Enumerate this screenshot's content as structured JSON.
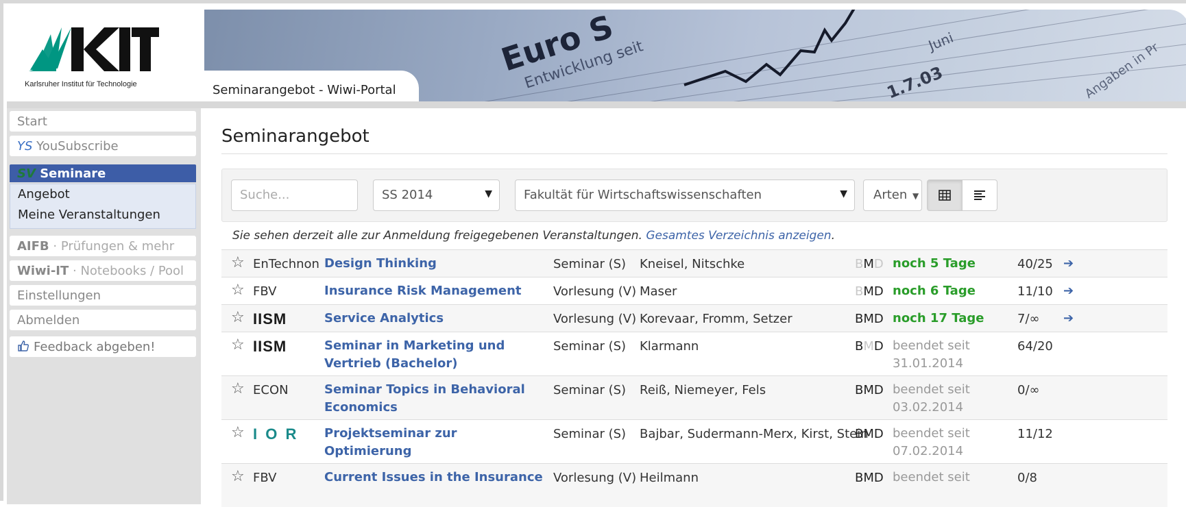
{
  "header": {
    "logo_text": "KIT",
    "logo_subtitle": "Karlsruher Institut für Technologie",
    "portal_title": "Seminarangebot - Wiwi-Portal",
    "banner_words": [
      "Euro S",
      "Entwicklung seit",
      "Juni",
      "1.7.03",
      "Angaben in Pr"
    ]
  },
  "sidebar": {
    "start": "Start",
    "yousubscribe_prefix": "YS",
    "yousubscribe_label": "YouSubscribe",
    "seminare_prefix": "SV",
    "seminare_label": "Seminare",
    "sub_angebot": "Angebot",
    "sub_meine": "Meine Veranstaltungen",
    "aifb_a": "AIFB",
    "aifb_sep": " · ",
    "aifb_b": "Prüfungen & mehr",
    "wiwi_a": "Wiwi-IT",
    "wiwi_sep": " · ",
    "wiwi_b": "Notebooks / Pool",
    "einstellungen": "Einstellungen",
    "abmelden": "Abmelden",
    "feedback": "Feedback abgeben!"
  },
  "main": {
    "title": "Seminarangebot",
    "search_placeholder": "Suche...",
    "semester": "SS 2014",
    "faculty": "Fakultät für Wirtschaftswissenschaften",
    "arten": "Arten",
    "info_text": "Sie sehen derzeit alle zur Anmeldung freigegebenen Veranstaltungen.",
    "info_link": "Gesamtes Verzeichnis anzeigen",
    "info_end": "."
  },
  "rows": [
    {
      "inst": "EnTechnon",
      "title": "Design Thinking",
      "type": "Seminar (S)",
      "prof": "Kneisel, Nitschke",
      "b": "B",
      "m": "M",
      "d": "D",
      "status": "noch 5 Tage",
      "count": "40/25"
    },
    {
      "inst": "FBV",
      "title": "Insurance Risk Management",
      "type": "Vorlesung (V)",
      "prof": "Maser",
      "b": "B",
      "m": "M",
      "d": "D",
      "status": "noch 6 Tage",
      "count": "11/10"
    },
    {
      "inst": "IISM",
      "title": "Service Analytics",
      "type": "Vorlesung (V)",
      "prof": "Korevaar, Fromm, Setzer",
      "b": "B",
      "m": "M",
      "d": "D",
      "status": "noch 17 Tage",
      "count": "7/∞"
    },
    {
      "inst": "IISM",
      "title": "Seminar in Marketing und Vertrieb (Bachelor)",
      "type": "Seminar (S)",
      "prof": "Klarmann",
      "b": "B",
      "m": "M",
      "d": "D",
      "status": "beendet seit 31.01.2014",
      "count": "64/20"
    },
    {
      "inst": "ECON",
      "title": "Seminar Topics in Behavioral Economics",
      "type": "Seminar (S)",
      "prof": "Reiß, Niemeyer, Fels",
      "b": "B",
      "m": "M",
      "d": "D",
      "status": "beendet seit 03.02.2014",
      "count": "0/∞"
    },
    {
      "inst": "I O R",
      "title": "Projektseminar zur Optimierung",
      "type": "Seminar (S)",
      "prof": "Bajbar, Sudermann-Merx, Kirst, Stein",
      "b": "B",
      "m": "M",
      "d": "D",
      "status": "beendet seit 07.02.2014",
      "count": "11/12"
    },
    {
      "inst": "FBV",
      "title": "Current Issues in the Insurance",
      "type": "Vorlesung (V)",
      "prof": "Heilmann",
      "b": "B",
      "m": "M",
      "d": "D",
      "status": "beendet seit",
      "count": "0/8"
    }
  ],
  "icons": {
    "star": "☆",
    "enter": "➔",
    "caret": "▾",
    "thumbs": "thumbs-up-icon"
  }
}
